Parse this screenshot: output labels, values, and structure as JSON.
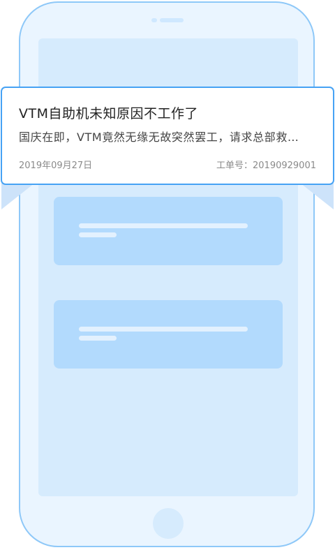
{
  "ticket": {
    "title": "VTM自助机未知原因不工作了",
    "description": "国庆在即，VTM竟然无缘无故突然罢工，请求总部救…",
    "date": "2019年09月27日",
    "number_label": "工单号：",
    "number": "20190929001"
  },
  "colors": {
    "accent": "#46a2f4",
    "phone_outline": "#8ec8f8",
    "placeholder": "#b2dafd"
  }
}
